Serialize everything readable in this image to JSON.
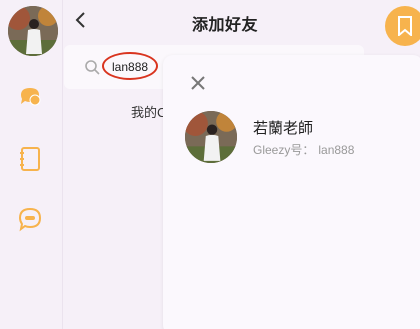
{
  "header": {
    "title": "添加好友"
  },
  "search": {
    "query": "lan888"
  },
  "my_code_label": "我的C",
  "result": {
    "name": "若蘭老師",
    "id_label": "Gleezy号：",
    "id_value": "lan888"
  },
  "icons": {
    "rail": [
      "chat-icon",
      "notebook-icon",
      "bubble-icon"
    ],
    "back": "chevron-left-icon",
    "bookmark": "bookmark-icon",
    "search": "search-icon",
    "close": "close-icon"
  },
  "colors": {
    "accent": "#f7b34d",
    "highlight": "#d9341f",
    "background": "#f6f0f8"
  }
}
